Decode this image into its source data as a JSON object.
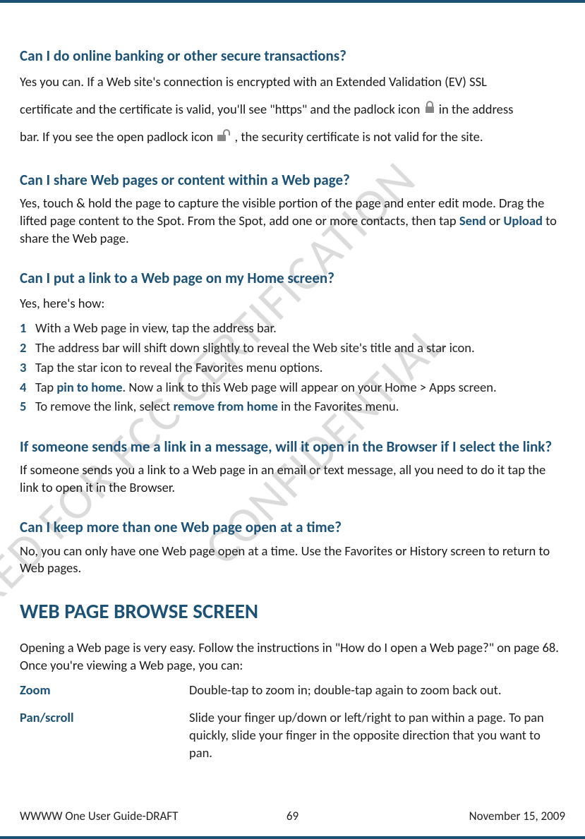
{
  "watermarks": {
    "line1": "PREPARED FOR FCC CERTIFICATION",
    "line2": "CONFIDENTIAL"
  },
  "sections": {
    "q1": {
      "heading": "Can I do online banking or other secure transactions?",
      "p1a": "Yes you can. If a Web site's connection is encrypted with an Extended Validation (EV) SSL",
      "p1b_a": "certificate and the certificate is valid, you'll see \"https\" and the padlock icon ",
      "p1b_b": " in the address",
      "p1c_a": "bar. If you see the open padlock icon ",
      "p1c_b": ", the security certificate is not valid for the site."
    },
    "q2": {
      "heading": "Can I share Web pages or content within a Web page?",
      "p_a": "Yes, touch & hold the page to capture the visible portion of the page and enter edit mode. Drag the lifted page content to the Spot. From the Spot, add one or more contacts, then tap ",
      "send": "Send",
      "or": " or ",
      "upload": "Upload",
      "p_b": " to share the Web page."
    },
    "q3": {
      "heading": "Can I put a link to a Web page on my Home screen?",
      "intro": "Yes, here's how:",
      "li1": "With a Web page in view, tap the address bar.",
      "li2": "The address bar will shift down slightly to reveal the Web site's title and a star icon.",
      "li3": "Tap the star icon to reveal the Favorites menu options.",
      "li4_a": "Tap ",
      "li4_bold": "pin to home",
      "li4_b": ". Now a link to this Web page will appear on your Home > Apps screen.",
      "li5_a": "To remove the link, select ",
      "li5_bold": "remove from home",
      "li5_b": " in the Favorites menu."
    },
    "q4": {
      "heading": "If someone sends me a link in a message, will it open in the Browser if I select the link?",
      "p": "If someone sends you a link to a Web page in an email or text message, all you need to do it tap the link to open it in the Browser."
    },
    "q5": {
      "heading": "Can I keep more than one Web page open at a time?",
      "p": "No, you can only have one Web page open at a time. Use the Favorites or History screen to return to Web pages."
    },
    "browse": {
      "title": "WEB PAGE BROWSE SCREEN",
      "intro": "Opening a Web page is very easy. Follow the instructions in \"How do I open a Web page?\" on page 68. Once you're viewing a Web page, you can:",
      "zoom_term": "Zoom",
      "zoom_def": "Double-tap to zoom in; double-tap again to zoom back out.",
      "pan_term": "Pan/scroll",
      "pan_def": "Slide your finger up/down or left/right to pan within a page. To pan quickly, slide your finger in the opposite direction that you want to pan."
    }
  },
  "numbers": {
    "n1": "1",
    "n2": "2",
    "n3": "3",
    "n4": "4",
    "n5": "5"
  },
  "footer": {
    "left": "WWWW One User Guide-DRAFT",
    "page": "69",
    "date": "November 15, 2009"
  }
}
